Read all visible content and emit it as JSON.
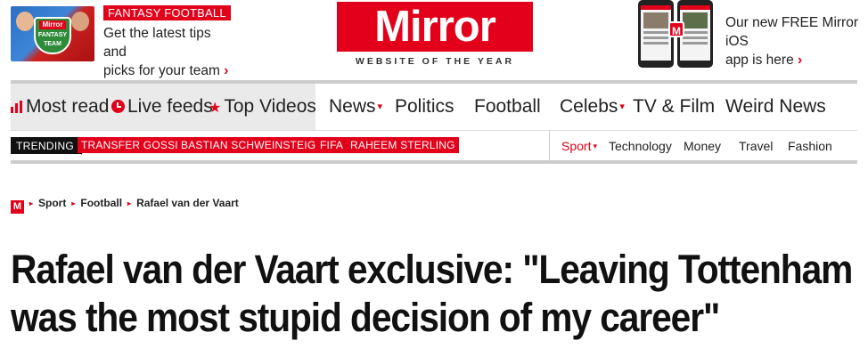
{
  "promo_left": {
    "tag": "FANTASY FOOTBALL",
    "line1": "Get the latest tips and",
    "line2": "picks for your team",
    "chevron": "›",
    "badge_top": "Mirror",
    "badge_text": "FANTASY TEAM"
  },
  "logo": {
    "name": "Mirror",
    "tagline": "WEBSITE OF THE YEAR"
  },
  "promo_right": {
    "line1": "Our new FREE Mirror iOS",
    "line2": "app is here",
    "chevron": "›",
    "app_badge": "M"
  },
  "nav": {
    "most_read": "Most read",
    "live_feeds": "Live feeds",
    "top_videos": "Top Videos",
    "star": "★",
    "caret": "▾",
    "items": [
      "News",
      "Politics",
      "Football",
      "Celebs",
      "TV & Film",
      "Weird News"
    ]
  },
  "trending": {
    "label": "TRENDING",
    "tags": [
      "TRANSFER GOSSIP",
      "BASTIAN SCHWEINSTEIGER",
      "FIFA",
      "RAHEEM STERLING"
    ]
  },
  "subnav": {
    "items": [
      "Sport",
      "Technology",
      "Money",
      "Travel",
      "Fashion"
    ],
    "caret": "▾"
  },
  "breadcrumb": {
    "home_icon": "M",
    "sep": "▸",
    "items": [
      "Sport",
      "Football",
      "Rafael van der Vaart"
    ]
  },
  "headline": {
    "line1": "Rafael van der Vaart exclusive: \"Leaving Tottenham",
    "line2": "was the most stupid decision of my career\""
  },
  "colors": {
    "brand_red": "#e2001a",
    "nav_grey": "#eaeaea"
  }
}
